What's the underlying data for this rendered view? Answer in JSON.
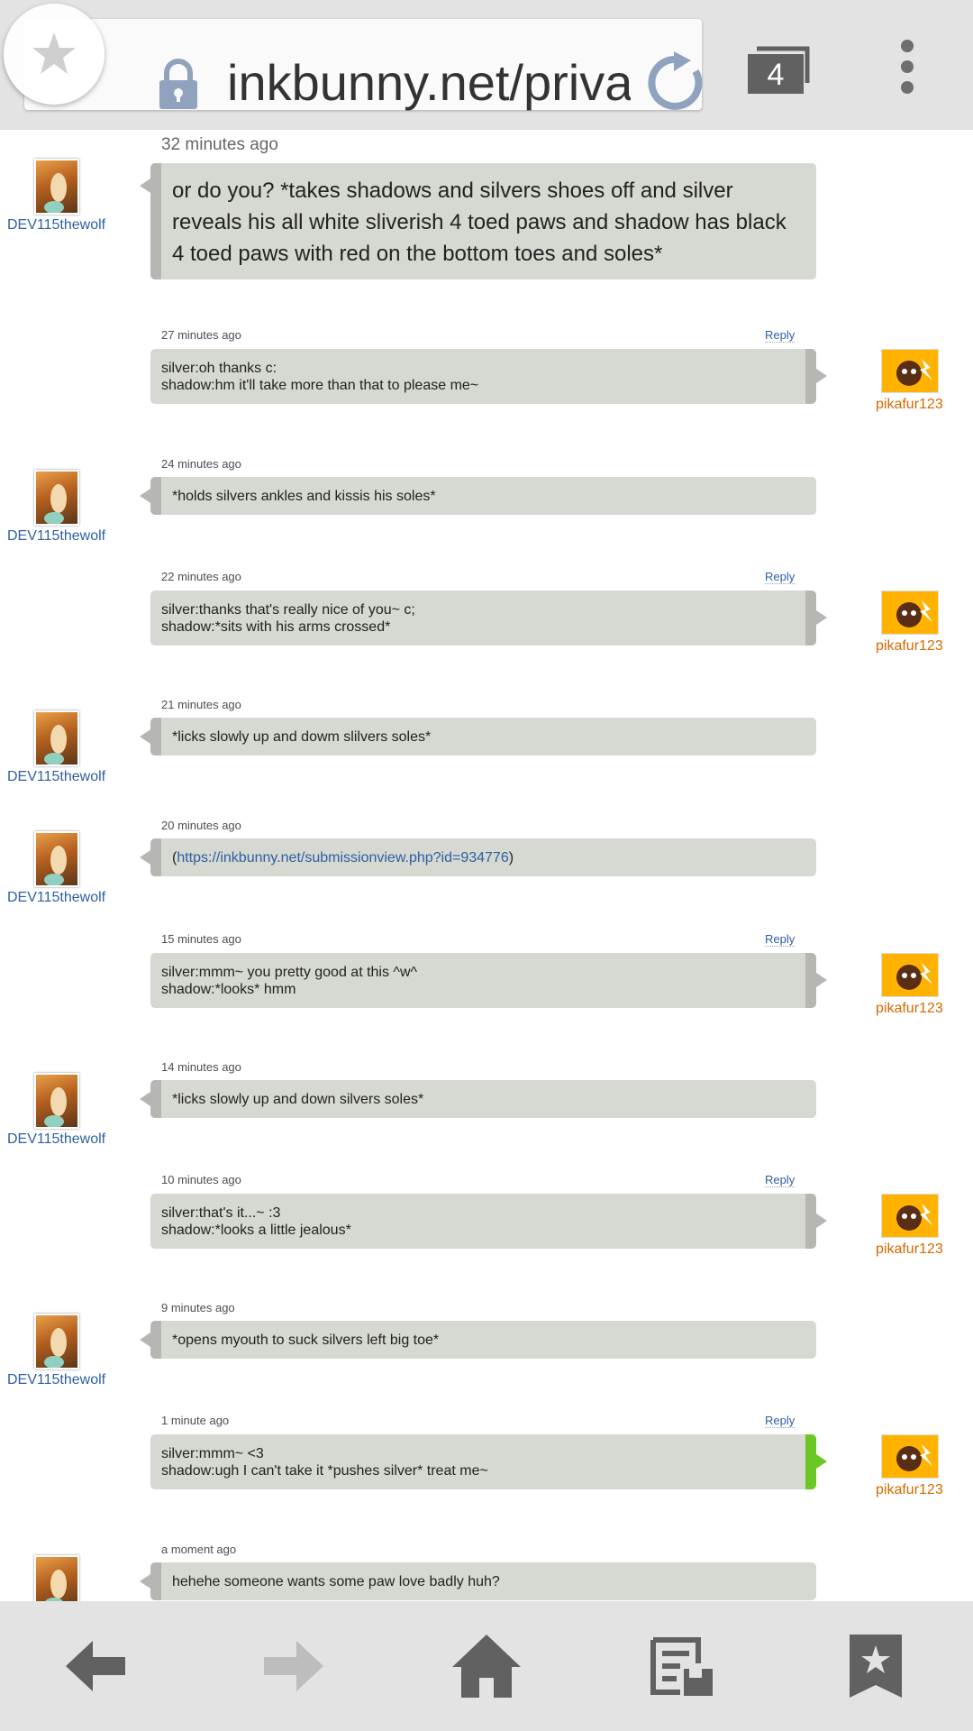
{
  "browser": {
    "url": "inkbunny.net/privatemessageview.php",
    "tab_count": "4"
  },
  "users": {
    "left": "DEV115thewolf",
    "right": "pikafur123"
  },
  "reply_label": "Reply",
  "messages": [
    {
      "time": "32 minutes ago",
      "text": "or do you? *takes shadows and silvers shoes off and silver reveals his all white sliverish 4 toed paws and shadow has black 4 toed paws with red on the bottom toes and soles*"
    },
    {
      "time": "27 minutes ago",
      "text": "silver:oh thanks c:\nshadow:hm it'll take more than that to please me~"
    },
    {
      "time": "24 minutes ago",
      "text": "*holds silvers ankles and kissis his soles*"
    },
    {
      "time": "22 minutes ago",
      "text": "silver:thanks that's really nice of you~ c;\nshadow:*sits with his arms crossed*"
    },
    {
      "time": "21 minutes ago",
      "text": "*licks slowly up and dowm slilvers soles*"
    },
    {
      "time": "20 minutes ago",
      "text_pre": "(",
      "link": "https://inkbunny.net/submissionview.php?id=934776",
      "text_post": ")"
    },
    {
      "time": "15 minutes ago",
      "text": "silver:mmm~ you pretty good at this ^w^\nshadow:*looks* hmm"
    },
    {
      "time": "14 minutes ago",
      "text": "*licks slowly up and down silvers soles*"
    },
    {
      "time": "10 minutes ago",
      "text": "silver:that's it...~ :3\nshadow:*looks a little jealous*"
    },
    {
      "time": "9 minutes ago",
      "text": "*opens myouth to suck silvers left big toe*"
    },
    {
      "time": "1 minute ago",
      "text": "silver:mmm~ <3\nshadow:ugh I can't take it *pushes silver* treat me~"
    },
    {
      "time": "a moment ago",
      "text": "hehehe someone wants some paw love badly huh?"
    }
  ],
  "icons": {
    "star": "star-icon",
    "lock": "lock-icon",
    "reload": "reload-icon",
    "tabs": "tabs-icon",
    "menu": "overflow-menu-icon",
    "back": "back-arrow-icon",
    "forward": "forward-arrow-icon",
    "home": "home-icon",
    "reading": "reading-list-icon",
    "bookmarks": "bookmarks-icon"
  },
  "colors": {
    "bubble": "#d6d8d2",
    "bubble_edge": "#b6b7b2",
    "latest_edge": "#6cc726",
    "left_user": "#2d5fa3",
    "right_user": "#d46a00",
    "toolbar": "#e3e3e3"
  }
}
